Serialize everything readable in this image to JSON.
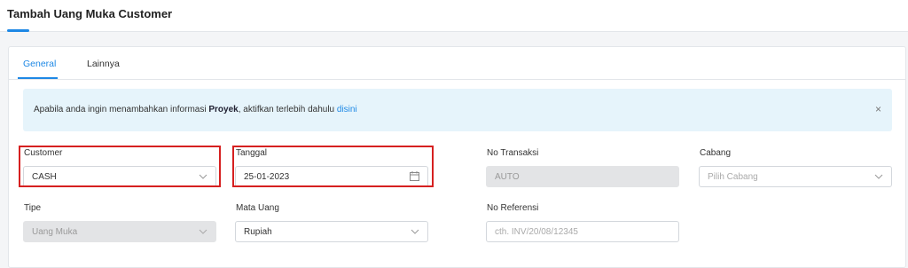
{
  "header": {
    "title": "Tambah Uang Muka Customer"
  },
  "tabs": [
    {
      "label": "General",
      "active": true
    },
    {
      "label": "Lainnya",
      "active": false
    }
  ],
  "alert": {
    "text_before": "Apabila anda ingin menambahkan informasi ",
    "bold_word": "Proyek",
    "text_middle": ", aktifkan terlebih dahulu ",
    "link_text": "disini",
    "close_symbol": "×"
  },
  "form": {
    "customer": {
      "label": "Customer",
      "value": "CASH"
    },
    "tanggal": {
      "label": "Tanggal",
      "value": "25-01-2023"
    },
    "no_transaksi": {
      "label": "No Transaksi",
      "value": "AUTO"
    },
    "cabang": {
      "label": "Cabang",
      "placeholder": "Pilih Cabang"
    },
    "tipe": {
      "label": "Tipe",
      "value": "Uang Muka"
    },
    "mata_uang": {
      "label": "Mata Uang",
      "value": "Rupiah"
    },
    "no_referensi": {
      "label": "No Referensi",
      "placeholder": "cth. INV/20/08/12345"
    }
  },
  "colors": {
    "accent": "#1e88e5",
    "highlight": "#d62020",
    "alert_bg": "#e6f4fb"
  }
}
